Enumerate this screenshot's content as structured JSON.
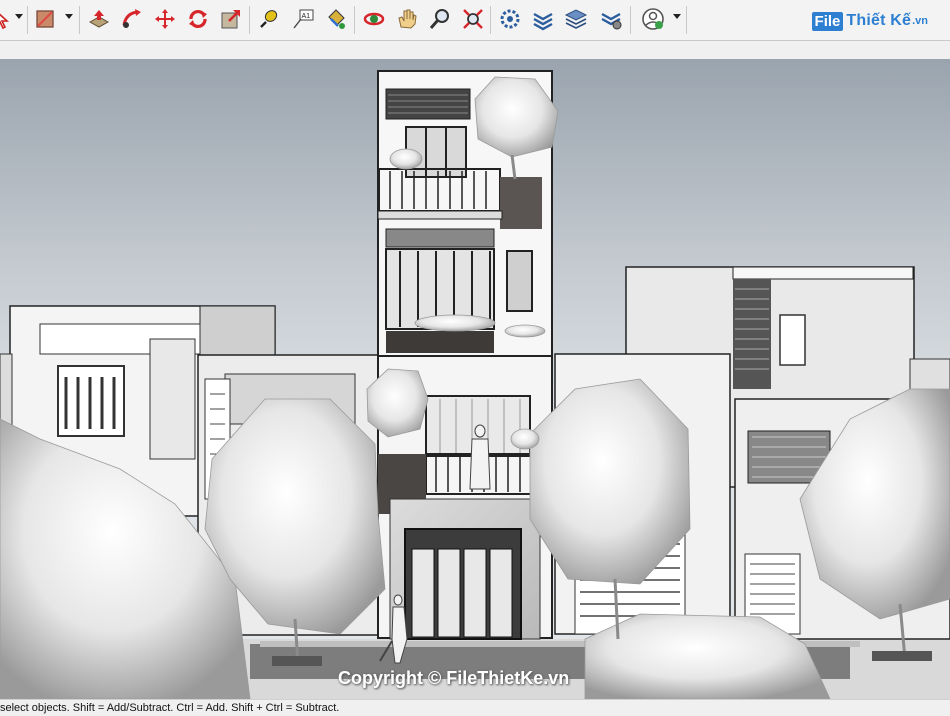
{
  "toolbar": {
    "icons": [
      "select-arrow-icon",
      "eraser-icon",
      "push-pull-icon",
      "follow-me-icon",
      "move-icon",
      "rotate-icon",
      "scale-icon",
      "tape-measure-icon",
      "text-label-icon",
      "paint-bucket-icon",
      "orbit-icon",
      "pan-icon",
      "zoom-icon",
      "zoom-extents-icon",
      "component-options-icon",
      "section-plane-icon",
      "layers-icon",
      "styles-icon",
      "account-icon"
    ],
    "text_tool_label": "A1"
  },
  "logo": {
    "box_text": "File",
    "text": "Thiết Kế",
    "suffix": ".vn",
    "color": "#2d7fd1"
  },
  "watermark": "Copyright © FileThietKe.vn",
  "status": {
    "text": "select objects. Shift = Add/Subtract. Ctrl = Add. Shift + Ctrl = Subtract."
  },
  "colors": {
    "toolbar_bg": "#f3f3f3",
    "red_tool": "#d7262b",
    "sky_top": "#9aa4ae",
    "sky_bottom": "#e4e7ea"
  }
}
